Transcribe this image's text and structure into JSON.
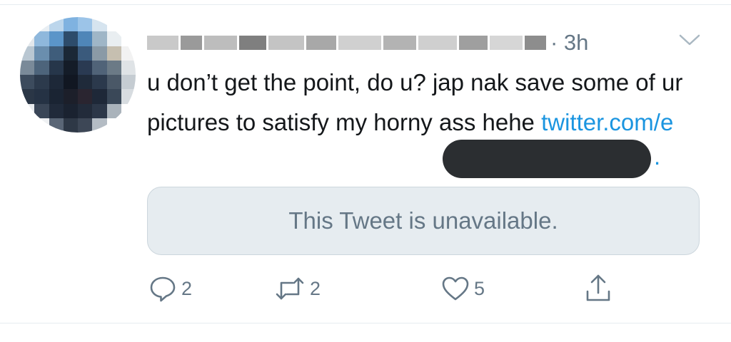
{
  "tweet": {
    "timestamp": "· 3h",
    "text_plain": "u don’t get the point, do u? jap nak save some of ur pictures to satisfy my horny ass hehe ",
    "link_text": "twitter.com/e",
    "link_tail": ".",
    "quoted_unavailable": "This Tweet is unavailable.",
    "actions": {
      "reply_count": "2",
      "retweet_count": "2",
      "like_count": "5"
    }
  },
  "icons": {
    "reply": "reply-icon",
    "retweet": "retweet-icon",
    "like": "heart-icon",
    "share": "share-icon",
    "menu": "chevron-down-icon"
  },
  "colors": {
    "link": "#1b95e0",
    "secondary_text": "#657786",
    "quote_bg": "#e6ecf0"
  }
}
